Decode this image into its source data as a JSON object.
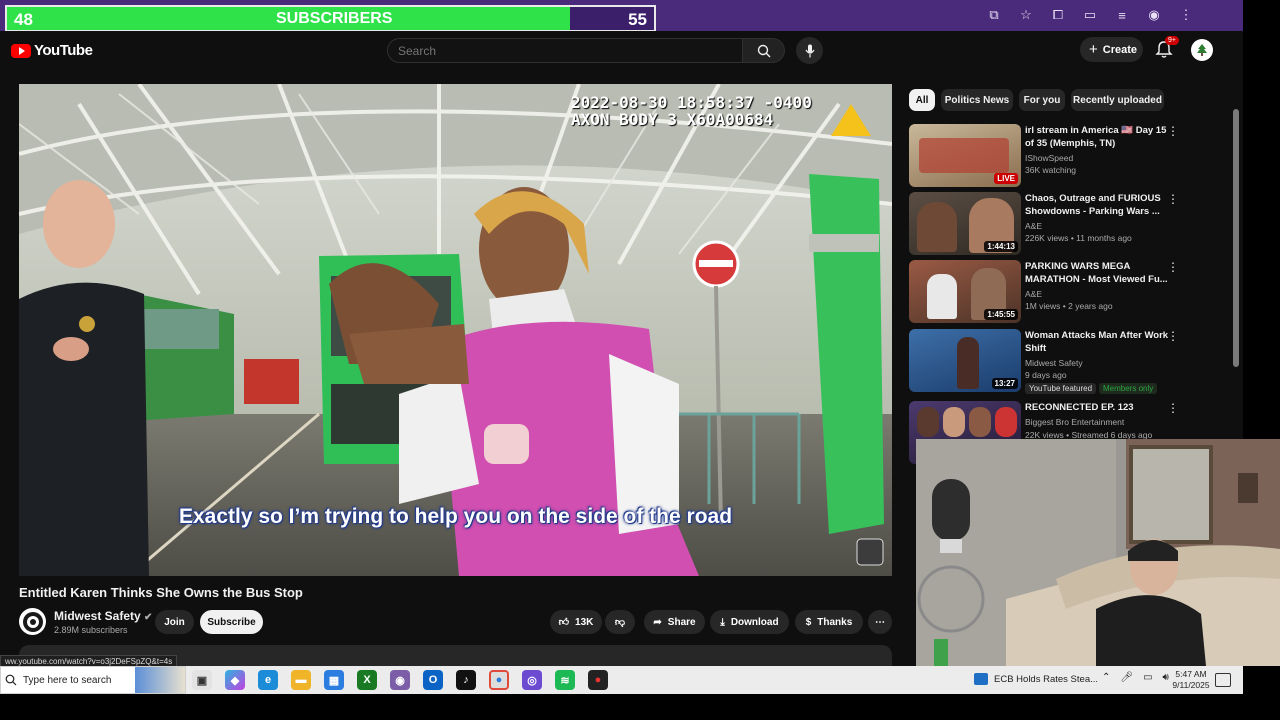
{
  "subscriber_goal": {
    "current": "48",
    "label": "SUBSCRIBERS",
    "goal": "55",
    "progress": 0.87
  },
  "browser": {
    "icons": [
      "cast-icon",
      "star-icon",
      "extensions-icon",
      "split-icon",
      "media-icon",
      "profile-icon",
      "menu-icon"
    ]
  },
  "youtube": {
    "logo_text": "YouTube",
    "search_placeholder": "Search",
    "create_label": "Create",
    "notification_badge": "9+"
  },
  "video": {
    "timestamp": "2022-08-30 18:58:37 -0400",
    "device": "AXON BODY 3 X60A00684",
    "caption": "Exactly so I’m trying to help you on the side of the road",
    "title": "Entitled Karen Thinks She Owns the Bus Stop",
    "channel": "Midwest Safety",
    "subscribers": "2.89M subscribers",
    "join_label": "Join",
    "subscribe_label": "Subscribe",
    "likes": "13K",
    "share_label": "Share",
    "download_label": "Download",
    "thanks_label": "Thanks",
    "hover_url": "ww.youtube.com/watch?v=o3j2DeFSpZQ&t=4s"
  },
  "chips": [
    "All",
    "Politics News",
    "For you",
    "Recently uploaded"
  ],
  "recommended": [
    {
      "title": "irl stream in America 🇺🇸 Day 15 of 35 (Memphis, TN)",
      "channel": "IShowSpeed",
      "meta": "36K watching",
      "overlay": "LIVE"
    },
    {
      "title": "Chaos, Outrage and FURIOUS Showdowns - Parking Wars ...",
      "channel": "A&E",
      "meta": "226K views • 11 months ago",
      "overlay": "1:44:13"
    },
    {
      "title": "PARKING WARS MEGA MARATHON - Most Viewed Fu...",
      "channel": "A&E",
      "meta": "1M views • 2 years ago",
      "overlay": "1:45:55"
    },
    {
      "title": "Woman Attacks Man After Work Shift",
      "channel": "Midwest Safety",
      "meta": "9 days ago",
      "overlay": "13:27",
      "badges": [
        "YouTube featured",
        "Members only"
      ]
    },
    {
      "title": "RECONNECTED EP. 123",
      "channel": "Biggest Bro Entertainment",
      "meta": "22K views • Streamed 6 days ago",
      "overlay": ""
    }
  ],
  "taskbar": {
    "search_placeholder": "Type here to search",
    "news": "ECB Holds Rates Stea...",
    "time": "5:47 AM",
    "date": "9/11/2025"
  }
}
